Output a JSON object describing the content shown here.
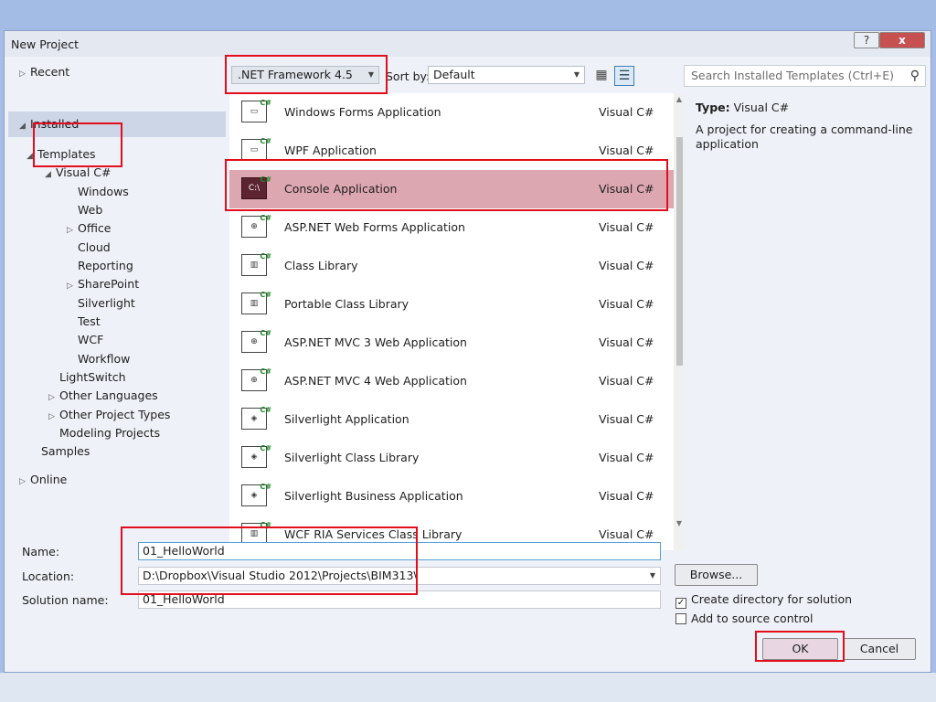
{
  "window": {
    "title": "New Project",
    "help": "?",
    "close": "x"
  },
  "nav": {
    "recent": "Recent",
    "installed": "Installed",
    "templates": "Templates",
    "visual_csharp": "Visual C#",
    "children": [
      "Windows",
      "Web",
      "Office",
      "Cloud",
      "Reporting",
      "SharePoint",
      "Silverlight",
      "Test",
      "WCF",
      "Workflow"
    ],
    "lightswitch": "LightSwitch",
    "other_languages": "Other Languages",
    "other_project_types": "Other Project Types",
    "modeling_projects": "Modeling Projects",
    "samples": "Samples",
    "online": "Online"
  },
  "toolbar": {
    "framework": ".NET Framework 4.5",
    "sort_label": "Sort by:",
    "sort_value": "Default",
    "search_placeholder": "Search Installed Templates (Ctrl+E)"
  },
  "templates": [
    {
      "name": "Windows Forms Application",
      "lang": "Visual C#"
    },
    {
      "name": "WPF Application",
      "lang": "Visual C#"
    },
    {
      "name": "Console Application",
      "lang": "Visual C#"
    },
    {
      "name": "ASP.NET Web Forms Application",
      "lang": "Visual C#"
    },
    {
      "name": "Class Library",
      "lang": "Visual C#"
    },
    {
      "name": "Portable Class Library",
      "lang": "Visual C#"
    },
    {
      "name": "ASP.NET MVC 3 Web Application",
      "lang": "Visual C#"
    },
    {
      "name": "ASP.NET MVC 4 Web Application",
      "lang": "Visual C#"
    },
    {
      "name": "Silverlight Application",
      "lang": "Visual C#"
    },
    {
      "name": "Silverlight Class Library",
      "lang": "Visual C#"
    },
    {
      "name": "Silverlight Business Application",
      "lang": "Visual C#"
    },
    {
      "name": "WCF RIA Services Class Library",
      "lang": "Visual C#"
    }
  ],
  "info": {
    "type_label": "Type:",
    "type_value": "Visual C#",
    "description": "A project for creating a command-line application"
  },
  "form": {
    "name_label": "Name:",
    "name_value": "01_HelloWorld",
    "location_label": "Location:",
    "location_value": "D:\\Dropbox\\Visual Studio 2012\\Projects\\BIM313\\",
    "solution_label": "Solution name:",
    "solution_value": "01_HelloWorld",
    "browse": "Browse...",
    "create_dir": "Create directory for solution",
    "create_dir_checked": true,
    "source_control": "Add to source control",
    "source_control_checked": false,
    "ok": "OK",
    "cancel": "Cancel"
  },
  "colors": {
    "highlight": "#e30e1b",
    "selected_row": "#dca7b0",
    "background": "#a8bde6"
  }
}
